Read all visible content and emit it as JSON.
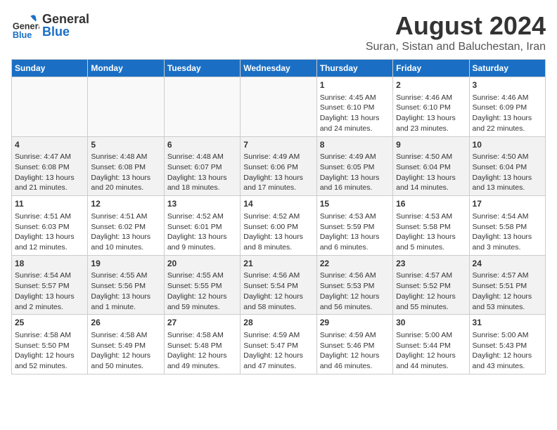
{
  "header": {
    "logo_general": "General",
    "logo_blue": "Blue",
    "month_year": "August 2024",
    "location": "Suran, Sistan and Baluchestan, Iran"
  },
  "weekdays": [
    "Sunday",
    "Monday",
    "Tuesday",
    "Wednesday",
    "Thursday",
    "Friday",
    "Saturday"
  ],
  "weeks": [
    [
      {
        "day": "",
        "info": ""
      },
      {
        "day": "",
        "info": ""
      },
      {
        "day": "",
        "info": ""
      },
      {
        "day": "",
        "info": ""
      },
      {
        "day": "1",
        "info": "Sunrise: 4:45 AM\nSunset: 6:10 PM\nDaylight: 13 hours and 24 minutes."
      },
      {
        "day": "2",
        "info": "Sunrise: 4:46 AM\nSunset: 6:10 PM\nDaylight: 13 hours and 23 minutes."
      },
      {
        "day": "3",
        "info": "Sunrise: 4:46 AM\nSunset: 6:09 PM\nDaylight: 13 hours and 22 minutes."
      }
    ],
    [
      {
        "day": "4",
        "info": "Sunrise: 4:47 AM\nSunset: 6:08 PM\nDaylight: 13 hours and 21 minutes."
      },
      {
        "day": "5",
        "info": "Sunrise: 4:48 AM\nSunset: 6:08 PM\nDaylight: 13 hours and 20 minutes."
      },
      {
        "day": "6",
        "info": "Sunrise: 4:48 AM\nSunset: 6:07 PM\nDaylight: 13 hours and 18 minutes."
      },
      {
        "day": "7",
        "info": "Sunrise: 4:49 AM\nSunset: 6:06 PM\nDaylight: 13 hours and 17 minutes."
      },
      {
        "day": "8",
        "info": "Sunrise: 4:49 AM\nSunset: 6:05 PM\nDaylight: 13 hours and 16 minutes."
      },
      {
        "day": "9",
        "info": "Sunrise: 4:50 AM\nSunset: 6:04 PM\nDaylight: 13 hours and 14 minutes."
      },
      {
        "day": "10",
        "info": "Sunrise: 4:50 AM\nSunset: 6:04 PM\nDaylight: 13 hours and 13 minutes."
      }
    ],
    [
      {
        "day": "11",
        "info": "Sunrise: 4:51 AM\nSunset: 6:03 PM\nDaylight: 13 hours and 12 minutes."
      },
      {
        "day": "12",
        "info": "Sunrise: 4:51 AM\nSunset: 6:02 PM\nDaylight: 13 hours and 10 minutes."
      },
      {
        "day": "13",
        "info": "Sunrise: 4:52 AM\nSunset: 6:01 PM\nDaylight: 13 hours and 9 minutes."
      },
      {
        "day": "14",
        "info": "Sunrise: 4:52 AM\nSunset: 6:00 PM\nDaylight: 13 hours and 8 minutes."
      },
      {
        "day": "15",
        "info": "Sunrise: 4:53 AM\nSunset: 5:59 PM\nDaylight: 13 hours and 6 minutes."
      },
      {
        "day": "16",
        "info": "Sunrise: 4:53 AM\nSunset: 5:58 PM\nDaylight: 13 hours and 5 minutes."
      },
      {
        "day": "17",
        "info": "Sunrise: 4:54 AM\nSunset: 5:58 PM\nDaylight: 13 hours and 3 minutes."
      }
    ],
    [
      {
        "day": "18",
        "info": "Sunrise: 4:54 AM\nSunset: 5:57 PM\nDaylight: 13 hours and 2 minutes."
      },
      {
        "day": "19",
        "info": "Sunrise: 4:55 AM\nSunset: 5:56 PM\nDaylight: 13 hours and 1 minute."
      },
      {
        "day": "20",
        "info": "Sunrise: 4:55 AM\nSunset: 5:55 PM\nDaylight: 12 hours and 59 minutes."
      },
      {
        "day": "21",
        "info": "Sunrise: 4:56 AM\nSunset: 5:54 PM\nDaylight: 12 hours and 58 minutes."
      },
      {
        "day": "22",
        "info": "Sunrise: 4:56 AM\nSunset: 5:53 PM\nDaylight: 12 hours and 56 minutes."
      },
      {
        "day": "23",
        "info": "Sunrise: 4:57 AM\nSunset: 5:52 PM\nDaylight: 12 hours and 55 minutes."
      },
      {
        "day": "24",
        "info": "Sunrise: 4:57 AM\nSunset: 5:51 PM\nDaylight: 12 hours and 53 minutes."
      }
    ],
    [
      {
        "day": "25",
        "info": "Sunrise: 4:58 AM\nSunset: 5:50 PM\nDaylight: 12 hours and 52 minutes."
      },
      {
        "day": "26",
        "info": "Sunrise: 4:58 AM\nSunset: 5:49 PM\nDaylight: 12 hours and 50 minutes."
      },
      {
        "day": "27",
        "info": "Sunrise: 4:58 AM\nSunset: 5:48 PM\nDaylight: 12 hours and 49 minutes."
      },
      {
        "day": "28",
        "info": "Sunrise: 4:59 AM\nSunset: 5:47 PM\nDaylight: 12 hours and 47 minutes."
      },
      {
        "day": "29",
        "info": "Sunrise: 4:59 AM\nSunset: 5:46 PM\nDaylight: 12 hours and 46 minutes."
      },
      {
        "day": "30",
        "info": "Sunrise: 5:00 AM\nSunset: 5:44 PM\nDaylight: 12 hours and 44 minutes."
      },
      {
        "day": "31",
        "info": "Sunrise: 5:00 AM\nSunset: 5:43 PM\nDaylight: 12 hours and 43 minutes."
      }
    ]
  ]
}
